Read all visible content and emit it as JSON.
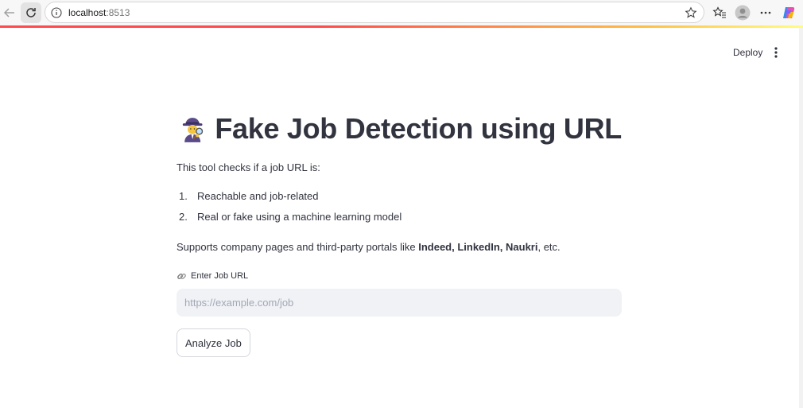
{
  "browser": {
    "url_host": "localhost",
    "url_port": ":8513",
    "icons": [
      "back-arrow-icon",
      "reload-icon",
      "info-icon",
      "star-icon",
      "favorites-icon",
      "profile-avatar",
      "more-icon",
      "copilot-icon"
    ]
  },
  "header": {
    "deploy_label": "Deploy",
    "menu_icon": "kebab-menu-icon"
  },
  "main": {
    "title_icon": "detective-emoji",
    "title": "Fake Job Detection using URL",
    "intro": "This tool checks if a job URL is:",
    "steps": [
      {
        "num": "1.",
        "text": "Reachable and job-related"
      },
      {
        "num": "2.",
        "text": "Real or fake using a machine learning model"
      }
    ],
    "supports_prefix": "Supports company pages and third-party portals like ",
    "supports_bold": "Indeed, LinkedIn, Naukri",
    "supports_suffix": ", etc.",
    "input_label_icon": "link-emoji",
    "input_label": "Enter Job URL",
    "input_value": "",
    "input_placeholder": "https://example.com/job",
    "button_label": "Analyze Job"
  },
  "colors": {
    "accent_red": "#ff4b4b",
    "text": "#31333f",
    "input_bg": "#f0f2f6"
  }
}
